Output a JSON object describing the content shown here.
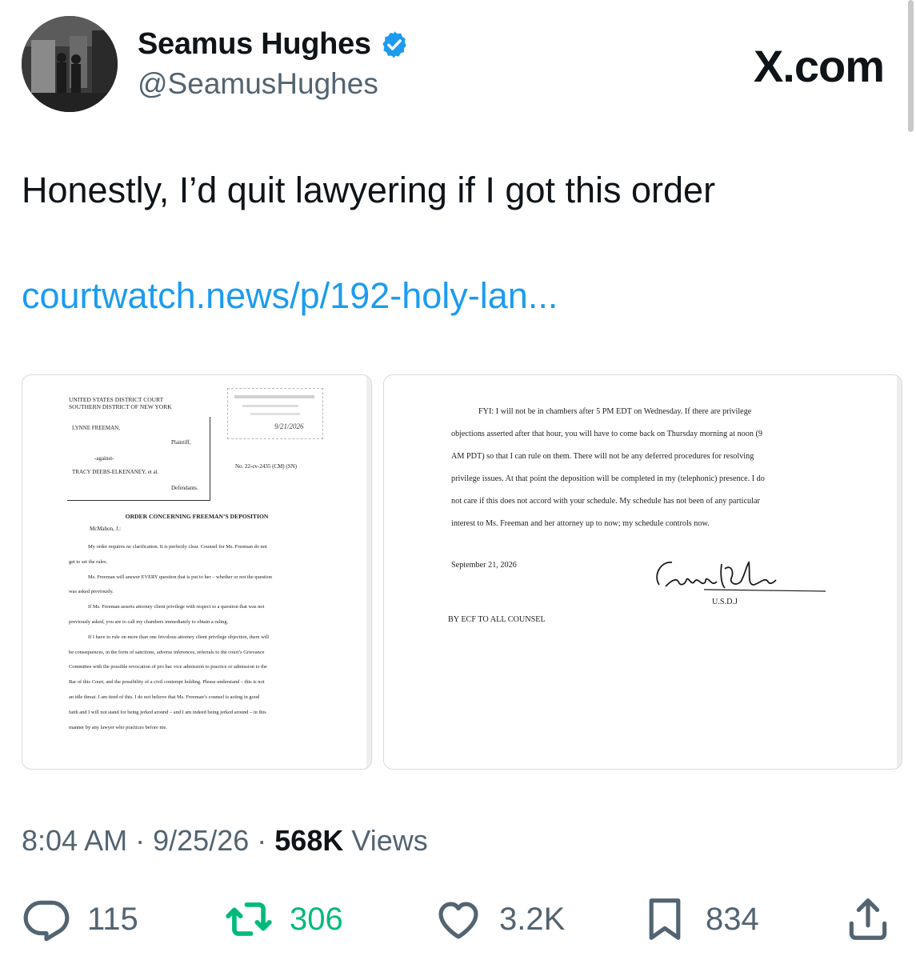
{
  "author": {
    "name": "Seamus Hughes",
    "handle": "@SeamusHughes",
    "verified": true
  },
  "brand": "X.com",
  "tweet": {
    "text": "Honestly, I’d quit lawyering if I got this order",
    "link": "courtwatch.news/p/192-holy-lan..."
  },
  "doc1": {
    "court_line1": "UNITED STATES DISTRICT COURT",
    "court_line2": "SOUTHERN DISTRICT OF NEW YORK",
    "plaintiff": "LYNNE FREEMAN,",
    "plaintiff_role": "Plaintiff,",
    "against": "-against-",
    "defendant": "TRACY DEEBS-ELKENANEY, et al.",
    "defendant_role": "Defendants.",
    "case_no": "No. 22-cv-2435 (CM) (SN)",
    "stamp_date": "9/21/2026",
    "title": "ORDER CONCERNING FREEMAN’S DEPOSITION",
    "judge": "McMahon, J.:",
    "lines": [
      {
        "t": "My order requires no clarification. It is perfectly clear. Counsel for Ms. Freeman do not",
        "indent": true
      },
      {
        "t": "get to set the rules.",
        "indent": false
      },
      {
        "t": "Ms. Freeman will answer EVERY question that is put to her – whether or not the question",
        "indent": true
      },
      {
        "t": "was asked previously.",
        "indent": false
      },
      {
        "t": "If Ms. Freeman asserts attorney client privilege with respect to a question that was not",
        "indent": true
      },
      {
        "t": "previously asked, you are to call my chambers immediately to obtain a ruling.",
        "indent": false
      },
      {
        "t": "If I have to rule on more than one frivolous attorney client privilege objection, there will",
        "indent": true
      },
      {
        "t": "be consequences, in the form of sanctions, adverse inferences, referrals to the court’s Grievance",
        "indent": false
      },
      {
        "t": "Committee with the possible revocation of pro hac vice admission to practice or admission to the",
        "indent": false
      },
      {
        "t": "Bar of this Court, and the possibility of a civil contempt holding. Please understand – this is not",
        "indent": false
      },
      {
        "t": "an idle threat. I am tired of this. I do not believe that Ms. Freeman’s counsel is acting in good",
        "indent": false
      },
      {
        "t": "faith and I will not stand for being jerked around – and I am indeed being jerked around – in this",
        "indent": false
      },
      {
        "t": "manner by any lawyer who practices before me.",
        "indent": false
      }
    ]
  },
  "doc2": {
    "lines": [
      {
        "t": "FYI: I will not be in chambers after 5 PM EDT on Wednesday. If there are privilege",
        "indent": true
      },
      {
        "t": "objections asserted after that hour, you will have to come back on Thursday morning at noon (9",
        "indent": false
      },
      {
        "t": "AM PDT) so that I can rule on them. There will not be any deferred procedures for resolving",
        "indent": false
      },
      {
        "t": "privilege issues. At that point the deposition will be completed in my (telephonic) presence. I do",
        "indent": false
      },
      {
        "t": "not care if this does not accord with your schedule. My schedule has not been of any particular",
        "indent": false
      },
      {
        "t": "interest to Ms. Freeman and her attorney up to now; my schedule controls now.",
        "indent": false
      }
    ],
    "date": "September 21, 2026",
    "signature_title": "U.S.D.J",
    "footer": "BY ECF TO ALL COUNSEL"
  },
  "meta": {
    "time": "8:04 AM",
    "sep1": "·",
    "date": "9/25/26",
    "sep2": "·",
    "views": "568K",
    "views_label": "Views"
  },
  "actions": {
    "replies": "115",
    "reposts": "306",
    "likes": "3.2K",
    "bookmarks": "834"
  },
  "colors": {
    "link": "#1d9bf0",
    "muted": "#536471",
    "repost": "#00ba7c",
    "verified": "#1d9bf0",
    "text": "#0f1419"
  },
  "icons": [
    "verified-badge-icon",
    "reply-icon",
    "repost-icon",
    "like-icon",
    "bookmark-icon",
    "share-icon"
  ]
}
